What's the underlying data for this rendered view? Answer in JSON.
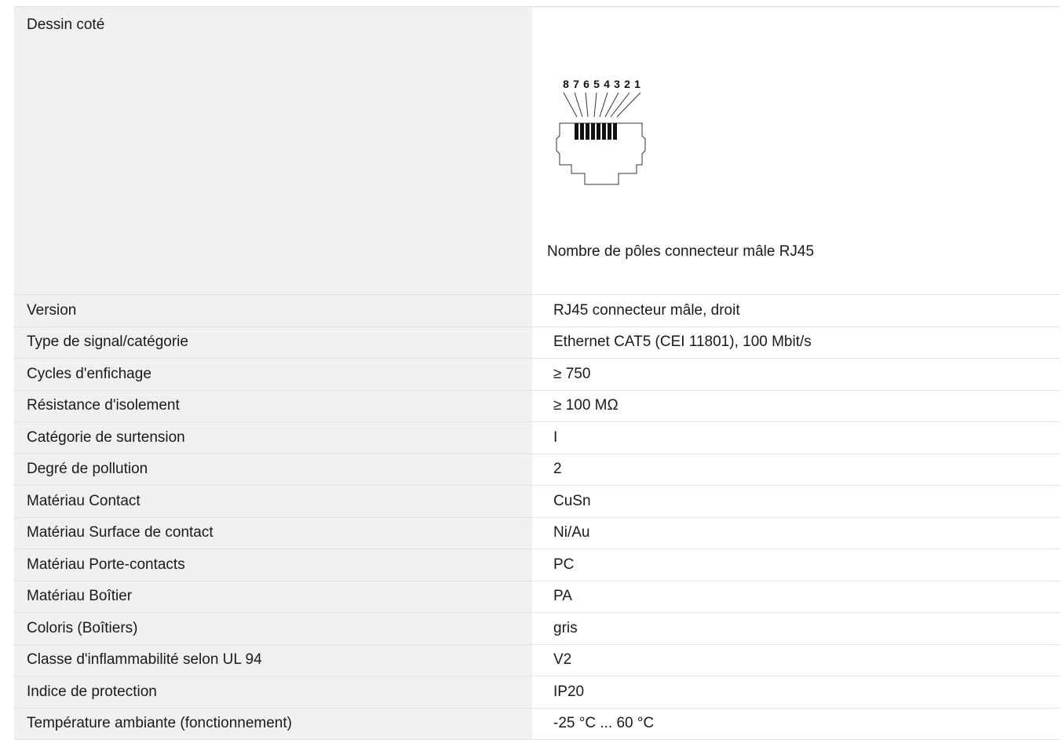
{
  "drawing": {
    "label": "Dessin coté",
    "pin_numbers": [
      "8",
      "7",
      "6",
      "5",
      "4",
      "3",
      "2",
      "1"
    ],
    "caption": "Nombre de pôles connecteur mâle RJ45"
  },
  "specs": [
    {
      "label": "Version",
      "value": "RJ45 connecteur mâle, droit"
    },
    {
      "label": "Type de signal/catégorie",
      "value": "Ethernet CAT5 (CEI 11801), 100 Mbit/s"
    },
    {
      "label": "Cycles d'enfichage",
      "value": "≥ 750"
    },
    {
      "label": "Résistance d'isolement",
      "value": "≥ 100 MΩ"
    },
    {
      "label": "Catégorie de surtension",
      "value": "I"
    },
    {
      "label": "Degré de pollution",
      "value": "2"
    },
    {
      "label": "Matériau Contact",
      "value": "CuSn"
    },
    {
      "label": "Matériau Surface de contact",
      "value": "Ni/Au"
    },
    {
      "label": "Matériau Porte-contacts",
      "value": "PC"
    },
    {
      "label": "Matériau Boîtier",
      "value": "PA"
    },
    {
      "label": "Coloris (Boîtiers)",
      "value": "gris"
    },
    {
      "label": "Classe d'inflammabilité selon UL 94",
      "value": "V2"
    },
    {
      "label": "Indice de protection",
      "value": "IP20"
    },
    {
      "label": "Température ambiante (fonctionnement)",
      "value": "-25 °C ... 60 °C"
    }
  ]
}
